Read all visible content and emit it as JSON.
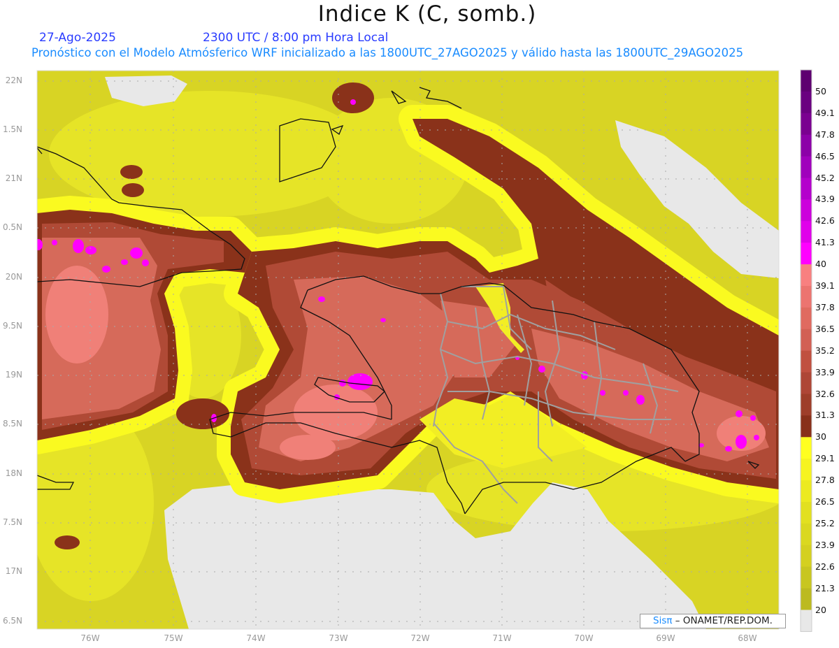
{
  "header": {
    "title": "Indice K (C, somb.)",
    "date": "27-Ago-2025",
    "time": "2300 UTC / 8:00 pm Hora Local",
    "description": "Pronóstico con el Modelo Atmósferico WRF inicializado a las 1800UTC_27AGO2025 y válido hasta las  1800UTC_29AGO2025"
  },
  "axes": {
    "lat_labels": [
      "22N",
      "1.5N",
      "21N",
      "0.5N",
      "20N",
      "9.5N",
      "19N",
      "8.5N",
      "18N",
      "7.5N",
      "17N",
      "6.5N"
    ],
    "lon_labels": [
      "76W",
      "75W",
      "74W",
      "73W",
      "72W",
      "71W",
      "70W",
      "69W",
      "68W"
    ]
  },
  "colorbar": {
    "labels": [
      "50",
      "49.1",
      "47.8",
      "46.5",
      "45.2",
      "43.9",
      "42.6",
      "41.3",
      "40",
      "39.1",
      "37.8",
      "36.5",
      "35.2",
      "33.9",
      "32.6",
      "31.3",
      "30",
      "29.1",
      "27.8",
      "26.5",
      "25.2",
      "23.9",
      "22.6",
      "21.3",
      "20"
    ],
    "colors": [
      "#5e0070",
      "#6a0080",
      "#7a0090",
      "#8c00a8",
      "#a000bc",
      "#b400cc",
      "#cc00dc",
      "#e000ea",
      "#ff00ff",
      "#f88080",
      "#ec7470",
      "#e06a60",
      "#d26054",
      "#c05040",
      "#ae4636",
      "#9e3e2a",
      "#88301a",
      "#ffff20",
      "#f6f420",
      "#ecea20",
      "#e2e020",
      "#dad820",
      "#d4d020",
      "#c8c620",
      "#bcba20",
      "#e8e8e8"
    ]
  },
  "credit": {
    "brand": "Sisπ",
    "text": "– ONAMET/REP.DOM."
  }
}
